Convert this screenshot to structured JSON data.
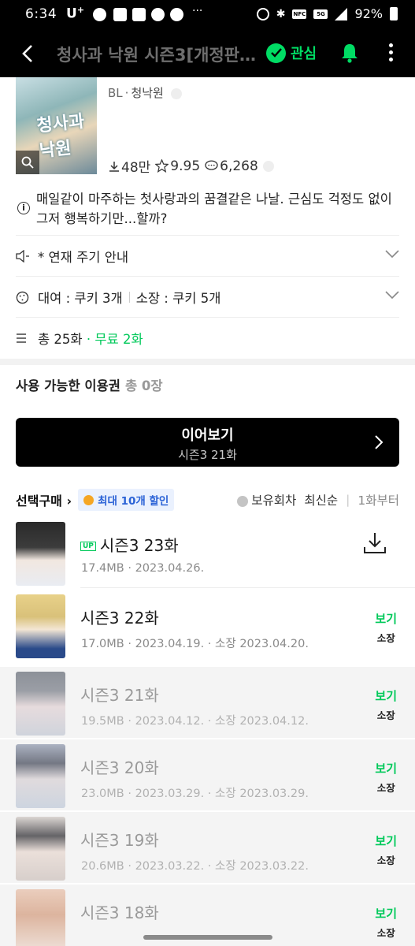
{
  "status_bar": {
    "time": "6:34",
    "carrier": "U",
    "carrier_sup": "+",
    "battery": "92%"
  },
  "app_bar": {
    "title": "청사과 낙원 시즌3[개정판...",
    "favorite_label": "관심"
  },
  "header": {
    "cover_text": "청사과 낙원",
    "genre": "BL",
    "author": "청낙원",
    "downloads": "48만",
    "rating": "9.95",
    "comments": "6,268"
  },
  "description": "매일같이 마주하는 첫사랑과의 꿈결같은 나날. 근심도 걱정도 없이 그저 행복하기만...할까?",
  "rows": {
    "schedule": "* 연재 주기 안내",
    "rent": "대여 : 쿠키 3개",
    "own": "소장 : 쿠키 5개",
    "total": "총 25화",
    "free": "· 무료 2화"
  },
  "ticket": {
    "label": "사용 가능한 이용권",
    "count": "총 0장"
  },
  "continue": {
    "label": "이어보기",
    "episode": "시즌3 21화"
  },
  "toolbar": {
    "select_buy": "선택구매",
    "sale": "최대 10개 할인",
    "owned": "보유회차",
    "newest": "최신순",
    "from_first": "1화부터"
  },
  "episodes": [
    {
      "up": "UP",
      "title": "시즌3 23화",
      "meta": "17.4MB · 2023.04.26.",
      "action": "download"
    },
    {
      "title": "시즌3 22화",
      "meta": "17.0MB · 2023.04.19. · 소장 2023.04.20.",
      "view": "보기",
      "own": "소장"
    },
    {
      "title": "시즌3 21화",
      "meta": "19.5MB · 2023.04.12. · 소장 2023.04.12.",
      "view": "보기",
      "own": "소장"
    },
    {
      "title": "시즌3 20화",
      "meta": "23.0MB · 2023.03.29. · 소장 2023.03.29.",
      "view": "보기",
      "own": "소장"
    },
    {
      "title": "시즌3 19화",
      "meta": "20.6MB · 2023.03.22. · 소장 2023.03.22.",
      "view": "보기",
      "own": "소장"
    },
    {
      "title": "시즌3 18화",
      "meta": "",
      "view": "보기",
      "own": "소장"
    }
  ],
  "colors": {
    "accent": "#00dc64",
    "sale_text": "#2a62d6"
  }
}
